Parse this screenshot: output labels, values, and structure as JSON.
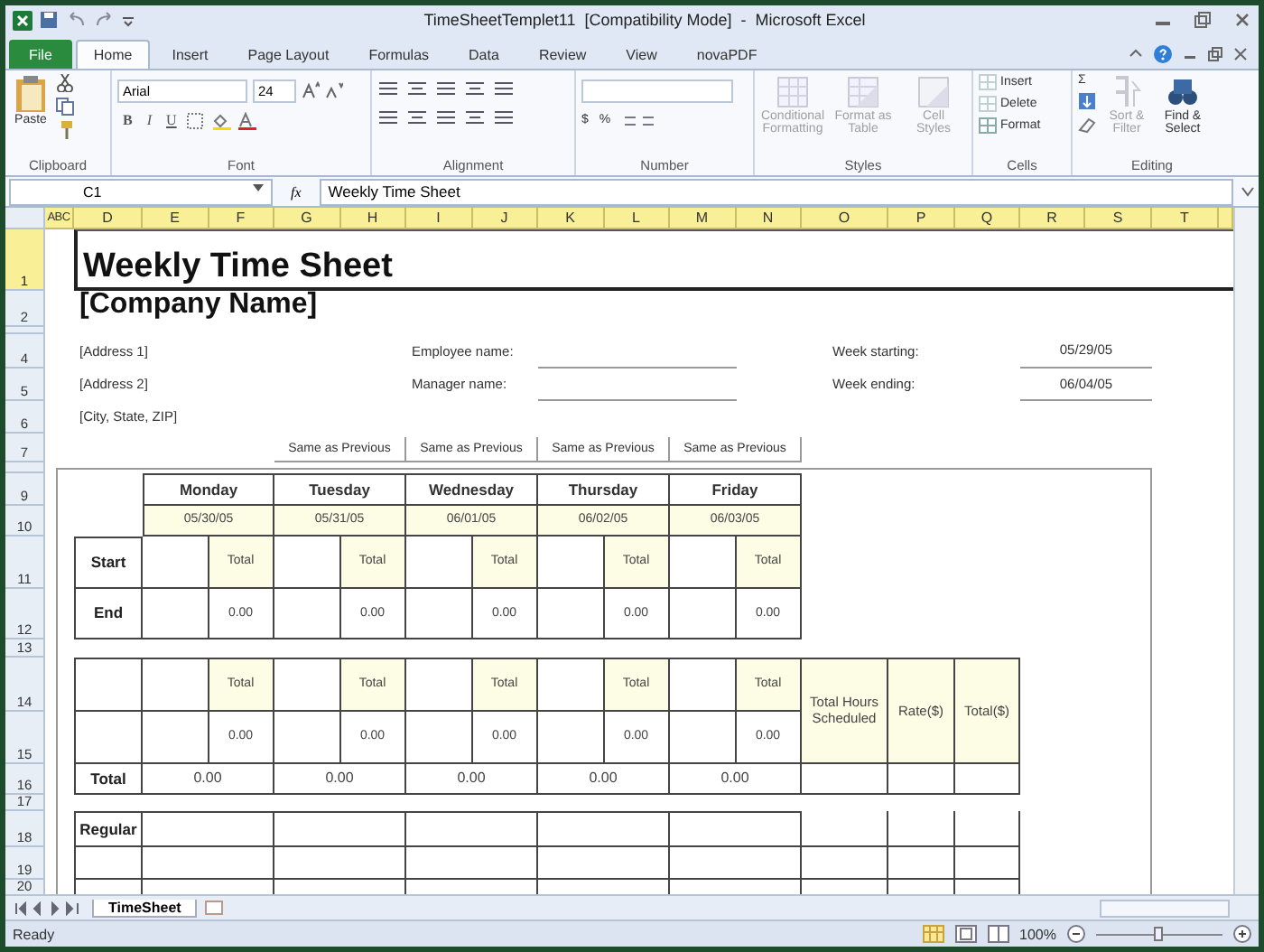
{
  "window": {
    "title": "TimeSheetTemplet11  [Compatibility Mode]  -  Microsoft Excel"
  },
  "ribbon_tabs": [
    {
      "label": "File",
      "kind": "file",
      "selected": false
    },
    {
      "label": "Home",
      "kind": "tab",
      "selected": true
    },
    {
      "label": "Insert",
      "kind": "tab",
      "selected": false
    },
    {
      "label": "Page Layout",
      "kind": "tab",
      "selected": false
    },
    {
      "label": "Formulas",
      "kind": "tab",
      "selected": false
    },
    {
      "label": "Data",
      "kind": "tab",
      "selected": false
    },
    {
      "label": "Review",
      "kind": "tab",
      "selected": false
    },
    {
      "label": "View",
      "kind": "tab",
      "selected": false
    },
    {
      "label": "novaPDF",
      "kind": "tab",
      "selected": false
    }
  ],
  "ribbon": {
    "clipboard": {
      "label": "Clipboard",
      "paste": "Paste"
    },
    "font": {
      "label": "Font",
      "name": "Arial",
      "size": "24",
      "glyphs": [
        "B",
        "I",
        "U"
      ]
    },
    "alignment": {
      "label": "Alignment"
    },
    "number": {
      "label": "Number",
      "symbols": [
        "$",
        "%"
      ]
    },
    "styles": {
      "label": "Styles",
      "buttons": [
        {
          "label": "Conditional Formatting",
          "disabled": true
        },
        {
          "label": "Format as Table",
          "disabled": true
        },
        {
          "label": "Cell Styles",
          "disabled": true
        }
      ]
    },
    "cells": {
      "label": "Cells",
      "buttons": [
        {
          "label": "Insert",
          "disabled": true
        },
        {
          "label": "Delete",
          "disabled": true
        },
        {
          "label": "Format",
          "disabled": false
        }
      ]
    },
    "editing": {
      "label": "Editing",
      "sum": "Σ",
      "buttons": [
        {
          "label": "Sort & Filter",
          "disabled": true
        },
        {
          "label": "Find & Select",
          "disabled": false
        }
      ]
    }
  },
  "formula_bar": {
    "name_box": "C1",
    "function_label": "fx",
    "formula": "Weekly Time Sheet"
  },
  "columns": [
    "ABC",
    "D",
    "E",
    "F",
    "G",
    "H",
    "I",
    "J",
    "K",
    "L",
    "M",
    "N",
    "O",
    "P",
    "Q",
    "R",
    "S",
    "T"
  ],
  "rows": [
    {
      "label": "1",
      "selected": true
    },
    {
      "label": "2",
      "selected": false
    },
    {
      "selected": false
    },
    {
      "label": "4",
      "selected": false
    },
    {
      "label": "5",
      "selected": false
    },
    {
      "label": "6",
      "selected": false
    },
    {
      "label": "7",
      "selected": false
    },
    {
      "selected": false
    },
    {
      "label": "9",
      "selected": false
    },
    {
      "label": "10",
      "selected": false
    },
    {
      "label": "11",
      "selected": false
    },
    {
      "label": "12",
      "selected": false
    },
    {
      "label": "13",
      "selected": false
    },
    {
      "label": "14",
      "selected": false
    },
    {
      "label": "15",
      "selected": false
    },
    {
      "label": "16",
      "selected": false
    },
    {
      "label": "17",
      "selected": false
    },
    {
      "label": "18",
      "selected": false
    },
    {
      "label": "19",
      "selected": false
    },
    {
      "label": "20",
      "selected": false
    }
  ],
  "sheet": {
    "title": "Weekly Time Sheet",
    "company": "[Company Name]",
    "address": [
      "[Address 1]",
      "[Address 2]",
      "[City, State, ZIP]"
    ],
    "people": [
      {
        "label": "Employee name:"
      },
      {
        "label": "Manager name:"
      }
    ],
    "week": [
      {
        "label": "Week starting:",
        "value": "05/29/05"
      },
      {
        "label": "Week ending:",
        "value": "06/04/05"
      }
    ],
    "copy_buttons": [
      "Same as Previous",
      "Same as Previous",
      "Same as Previous",
      "Same as Previous"
    ],
    "row_labels": {
      "start": "Start",
      "end": "End",
      "total": "Total",
      "regular": "Regular"
    },
    "days": [
      {
        "name": "Monday",
        "date": "05/30/05",
        "blocks": [
          {
            "label": "Total",
            "value": "0.00"
          },
          {
            "label": "Total",
            "value": "0.00"
          }
        ],
        "total": "0.00"
      },
      {
        "name": "Tuesday",
        "date": "05/31/05",
        "blocks": [
          {
            "label": "Total",
            "value": "0.00"
          },
          {
            "label": "Total",
            "value": "0.00"
          }
        ],
        "total": "0.00"
      },
      {
        "name": "Wednesday",
        "date": "06/01/05",
        "blocks": [
          {
            "label": "Total",
            "value": "0.00"
          },
          {
            "label": "Total",
            "value": "0.00"
          }
        ],
        "total": "0.00"
      },
      {
        "name": "Thursday",
        "date": "06/02/05",
        "blocks": [
          {
            "label": "Total",
            "value": "0.00"
          },
          {
            "label": "Total",
            "value": "0.00"
          }
        ],
        "total": "0.00"
      },
      {
        "name": "Friday",
        "date": "06/03/05",
        "blocks": [
          {
            "label": "Total",
            "value": "0.00"
          },
          {
            "label": "Total",
            "value": "0.00"
          }
        ],
        "total": "0.00"
      }
    ],
    "summary_headers": [
      "Total Hours Scheduled",
      "Rate($)",
      "Total($)"
    ]
  },
  "sheet_tabs": [
    {
      "label": "TimeSheet",
      "selected": true
    }
  ],
  "status_bar": {
    "text": "Ready",
    "zoom": "100%",
    "zoom_slider": {
      "level": 0.5
    }
  }
}
